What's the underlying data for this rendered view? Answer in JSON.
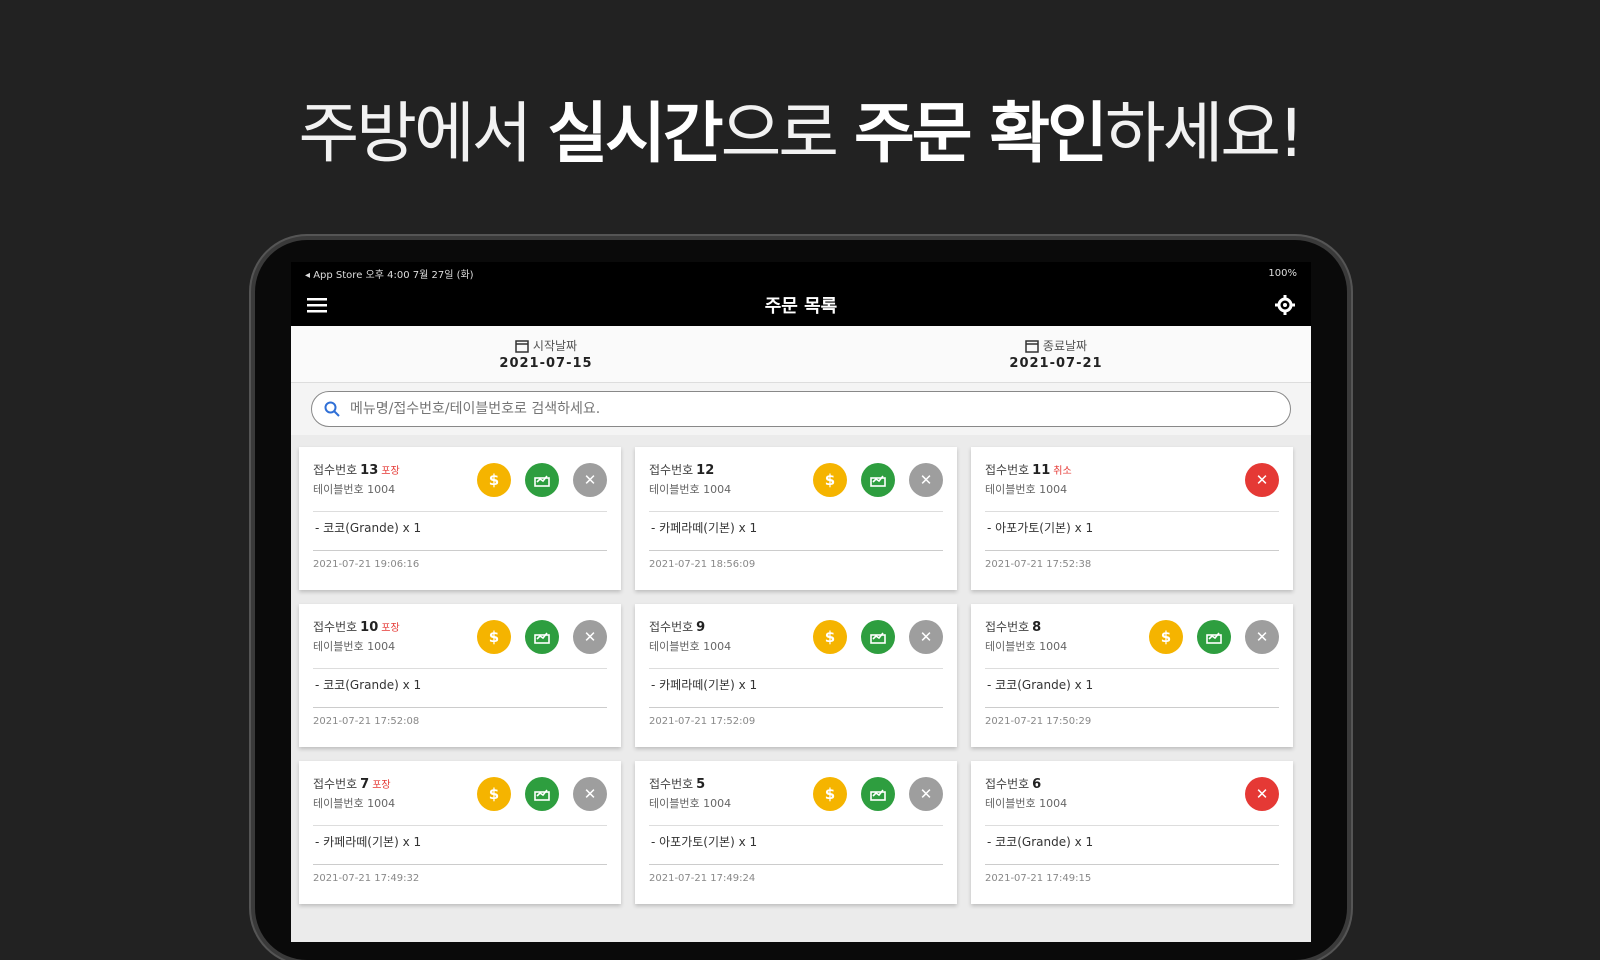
{
  "headline": {
    "part1": "주방에서 ",
    "part2": "실시간",
    "part3": "으로 ",
    "part4": "주문 확인",
    "part5": "하세요!"
  },
  "statusbar": {
    "left": "◂ App Store  오후 4:00  7월 27일 (화)",
    "right": "100%"
  },
  "appbar": {
    "title": "주문 목록",
    "menu_icon": "hamburger-icon",
    "settings_icon": "gear-icon"
  },
  "dates": {
    "start_label": "시작날짜",
    "start_value": "2021-07-15",
    "end_label": "종료날짜",
    "end_value": "2021-07-21"
  },
  "search": {
    "placeholder": "메뉴명/접수번호/테이블번호로 검색하세요."
  },
  "colors": {
    "pay": "#f5b400",
    "done": "#2e9e3f",
    "cancel": "#9e9e9e",
    "delete": "#e53935"
  },
  "orders": [
    {
      "label": "접수번호",
      "number": "13",
      "tag": "포장",
      "table": "테이블번호 1004",
      "item": "- 코코(Grande) x 1",
      "time": "2021-07-21 19:06:16"
    },
    {
      "label": "접수번호",
      "number": "12",
      "tag": "",
      "table": "테이블번호 1004",
      "item": "- 카페라떼(기본) x 1",
      "time": "2021-07-21 18:56:09"
    },
    {
      "label": "접수번호",
      "number": "11",
      "tag": "취소",
      "table": "테이블번호 1004",
      "item": "- 아포가토(기본) x 1",
      "time": "2021-07-21 17:52:38"
    },
    {
      "label": "접수번호",
      "number": "10",
      "tag": "포장",
      "table": "테이블번호 1004",
      "item": "- 코코(Grande) x 1",
      "time": "2021-07-21 17:52:08"
    },
    {
      "label": "접수번호",
      "number": "9",
      "tag": "",
      "table": "테이블번호 1004",
      "item": "- 카페라떼(기본) x 1",
      "time": "2021-07-21 17:52:09"
    },
    {
      "label": "접수번호",
      "number": "8",
      "tag": "",
      "table": "테이블번호 1004",
      "item": "- 코코(Grande) x 1",
      "time": "2021-07-21 17:50:29"
    },
    {
      "label": "접수번호",
      "number": "7",
      "tag": "포장",
      "table": "테이블번호 1004",
      "item": "- 카페라떼(기본) x 1",
      "time": "2021-07-21 17:49:32"
    },
    {
      "label": "접수번호",
      "number": "5",
      "tag": "",
      "table": "테이블번호 1004",
      "item": "- 아포가토(기본) x 1",
      "time": "2021-07-21 17:49:24"
    },
    {
      "label": "접수번호",
      "number": "6",
      "tag": "",
      "table": "테이블번호 1004",
      "item": "- 코코(Grande) x 1",
      "time": "2021-07-21 17:49:15"
    }
  ]
}
